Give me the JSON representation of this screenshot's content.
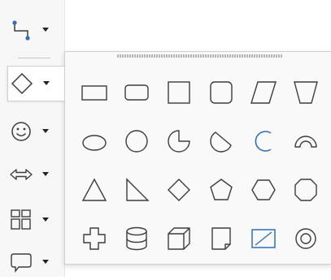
{
  "colors": {
    "shape_stroke": "#3c3c3c",
    "accent_blue": "#2e6fb7",
    "panel_bg": "#f9f9f9",
    "toolbar_bg": "#f7f7f7"
  },
  "toolbar": {
    "tools": [
      {
        "name": "connector",
        "icon": "connector-icon"
      },
      {
        "name": "basic-shapes",
        "icon": "diamond-icon",
        "active": true
      },
      {
        "name": "symbol-shapes",
        "icon": "smiley-icon"
      },
      {
        "name": "block-arrows",
        "icon": "double-arrow-icon"
      },
      {
        "name": "flowchart",
        "icon": "flowchart-icon"
      },
      {
        "name": "callouts",
        "icon": "callout-icon"
      }
    ]
  },
  "shapes_panel": {
    "rows": [
      [
        "rectangle-icon",
        "rounded-rectangle-icon",
        "square-icon",
        "rounded-square-icon",
        "parallelogram-icon",
        "trapezoid-icon"
      ],
      [
        "ellipse-icon",
        "circle-icon",
        "circle-pie-icon",
        "circle-segment-icon",
        "arc-icon",
        "block-arc-icon"
      ],
      [
        "isosceles-triangle-icon",
        "right-triangle-icon",
        "diamond-icon",
        "pentagon-icon",
        "hexagon-icon",
        "octagon-icon"
      ],
      [
        "cross-icon",
        "cylinder-icon",
        "cube-icon",
        "folded-corner-icon",
        "frame-icon",
        "ring-icon"
      ]
    ]
  }
}
